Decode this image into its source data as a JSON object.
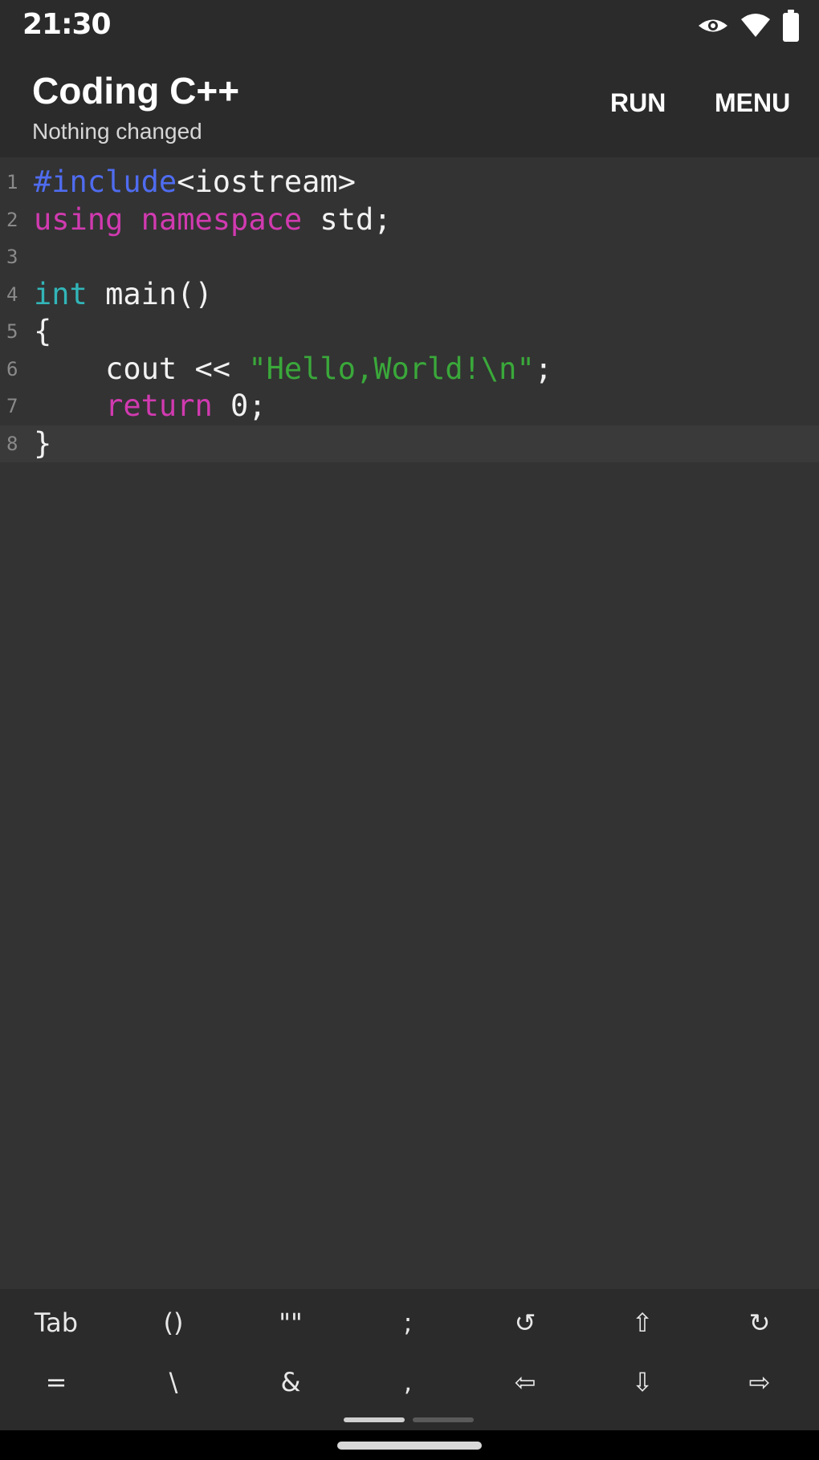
{
  "status_bar": {
    "time": "21:30",
    "icons": [
      "eye-icon",
      "wifi-icon",
      "battery-icon"
    ]
  },
  "app_bar": {
    "title": "Coding C++",
    "subtitle": "Nothing changed",
    "actions": {
      "run": "RUN",
      "menu": "MENU"
    }
  },
  "editor": {
    "current_line": 8,
    "lines": [
      {
        "number": "1",
        "tokens": [
          {
            "t": "#include",
            "c": "pre"
          },
          {
            "t": "<iostream>",
            "c": "def"
          }
        ]
      },
      {
        "number": "2",
        "tokens": [
          {
            "t": "using",
            "c": "kw"
          },
          {
            "t": " ",
            "c": "def"
          },
          {
            "t": "namespace",
            "c": "kw"
          },
          {
            "t": " std;",
            "c": "def"
          }
        ]
      },
      {
        "number": "3",
        "tokens": []
      },
      {
        "number": "4",
        "tokens": [
          {
            "t": "int",
            "c": "type"
          },
          {
            "t": " main()",
            "c": "def"
          }
        ]
      },
      {
        "number": "5",
        "tokens": [
          {
            "t": "{",
            "c": "def"
          }
        ]
      },
      {
        "number": "6",
        "tokens": [
          {
            "t": "    cout << ",
            "c": "def"
          },
          {
            "t": "\"Hello,World!\\n\"",
            "c": "str"
          },
          {
            "t": ";",
            "c": "def"
          }
        ]
      },
      {
        "number": "7",
        "tokens": [
          {
            "t": "    ",
            "c": "def"
          },
          {
            "t": "return",
            "c": "kw"
          },
          {
            "t": " 0;",
            "c": "def"
          }
        ]
      },
      {
        "number": "8",
        "tokens": [
          {
            "t": "}",
            "c": "def"
          }
        ]
      }
    ]
  },
  "shortcut_keys": {
    "row1": [
      {
        "label": "Tab",
        "name": "tab-key"
      },
      {
        "label": "()",
        "name": "parentheses-key"
      },
      {
        "label": "\"\"",
        "name": "quotes-key"
      },
      {
        "label": ";",
        "name": "semicolon-key"
      },
      {
        "label": "↺",
        "name": "undo-key"
      },
      {
        "label": "⇧",
        "name": "shift-up-key"
      },
      {
        "label": "↻",
        "name": "redo-key"
      }
    ],
    "row2": [
      {
        "label": "=",
        "name": "equals-key"
      },
      {
        "label": "\\",
        "name": "backslash-key"
      },
      {
        "label": "&",
        "name": "ampersand-key"
      },
      {
        "label": ",",
        "name": "comma-key"
      },
      {
        "label": "⇦",
        "name": "arrow-left-key"
      },
      {
        "label": "⇩",
        "name": "arrow-down-key"
      },
      {
        "label": "⇨",
        "name": "arrow-right-key"
      }
    ]
  },
  "colors": {
    "background": "#333333",
    "bar": "#2b2b2b",
    "preprocessor": "#4f6cf0",
    "keyword": "#d13ab0",
    "type": "#32b5b8",
    "string": "#3aa83a"
  }
}
